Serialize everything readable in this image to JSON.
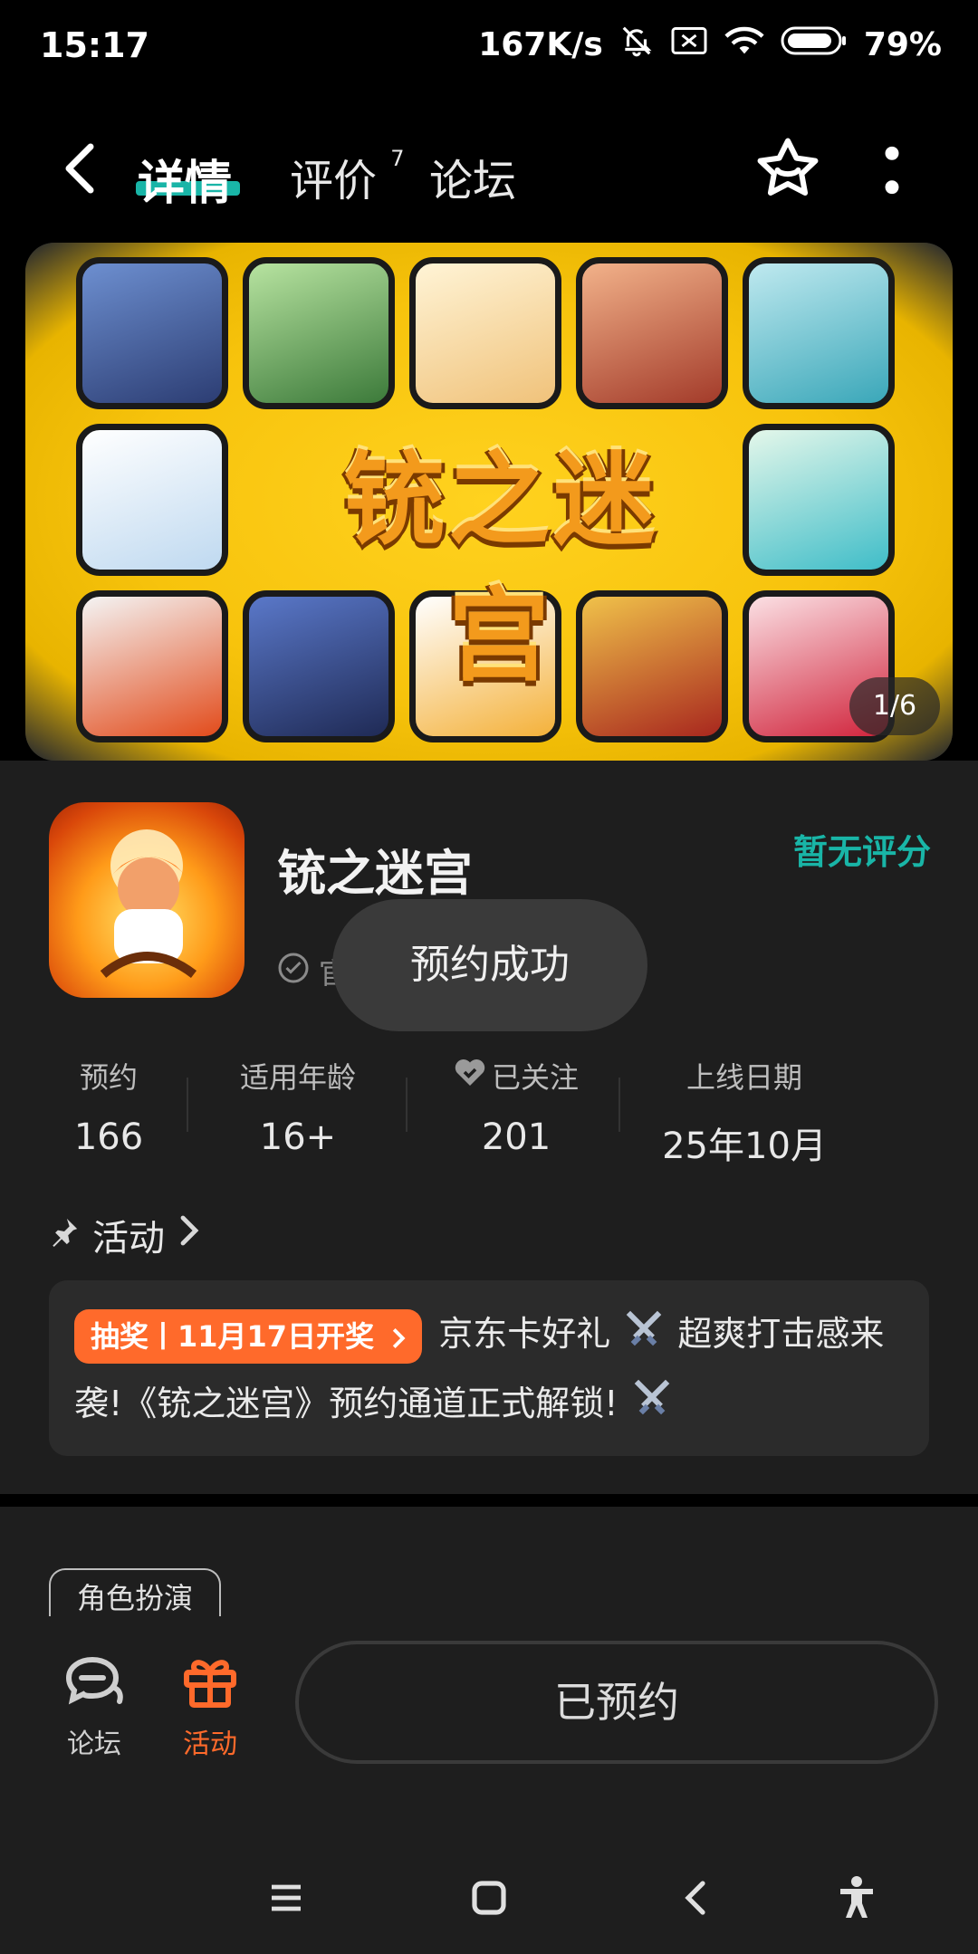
{
  "status_bar": {
    "time": "15:17",
    "net_speed": "167K/s",
    "battery": "79%"
  },
  "header": {
    "tabs": [
      {
        "label": "详情"
      },
      {
        "label": "评价",
        "badge": "7"
      },
      {
        "label": "论坛"
      }
    ]
  },
  "banner": {
    "title": "铳之迷宫",
    "counter": "1/6"
  },
  "app": {
    "name": "铳之迷宫",
    "rating": "暂无评分",
    "verified_partial": "官"
  },
  "toast": "预约成功",
  "stats": [
    {
      "label": "预约",
      "value": "166"
    },
    {
      "label": "适用年龄",
      "value": "16+"
    },
    {
      "label": "已关注",
      "value": "201"
    },
    {
      "label": "上线日期",
      "value": "25年10月"
    }
  ],
  "activity": {
    "heading": "活动",
    "badge": "抽奖丨11月17日开奖",
    "text_1": "京东卡好礼",
    "text_2": "超爽打击感来袭!《铳之迷宫》预约通道正式解锁!"
  },
  "genre_tag": "角色扮演",
  "bottom_bar": {
    "forum_label": "论坛",
    "activity_label": "活动",
    "reserve_button": "已预约"
  },
  "colors": {
    "accent": "#19b5a7",
    "orange": "#ff6a2b"
  }
}
